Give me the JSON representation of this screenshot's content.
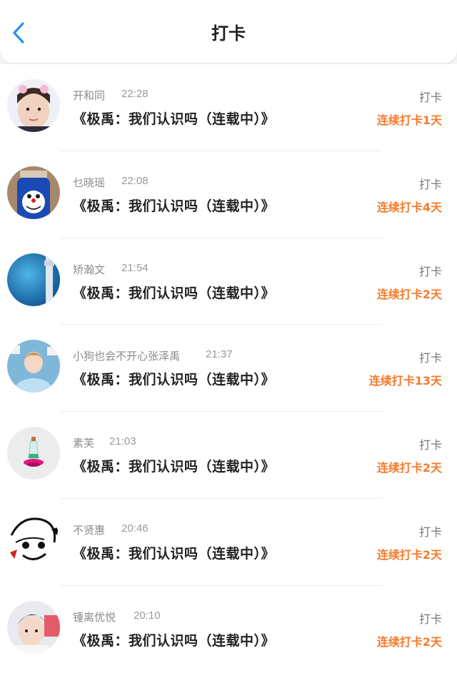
{
  "header": {
    "title": "打卡",
    "back_icon": "chevron-left-icon",
    "accent_color": "#2b8ff0"
  },
  "colors": {
    "streak": "#f57a2b",
    "name": "#8a8a8a",
    "title_text": "#222222"
  },
  "entries": [
    {
      "name": "开和同",
      "time": "22:28",
      "book": "《极禹：我们认识吗（连载中）》",
      "type": "打卡",
      "streak": "连续打卡1天"
    },
    {
      "name": "乜晓瑶",
      "time": "22:08",
      "book": "《极禹：我们认识吗（连载中）》",
      "type": "打卡",
      "streak": "连续打卡4天"
    },
    {
      "name": "矫瀚文",
      "time": "21:54",
      "book": "《极禹：我们认识吗（连载中）》",
      "type": "打卡",
      "streak": "连续打卡2天"
    },
    {
      "name": "小狗也会不开心张泽禹",
      "time": "21:37",
      "book": "《极禹：我们认识吗（连载中）》",
      "type": "打卡",
      "streak": "连续打卡13天"
    },
    {
      "name": "素芙",
      "time": "21:03",
      "book": "《极禹：我们认识吗（连载中）》",
      "type": "打卡",
      "streak": "连续打卡2天"
    },
    {
      "name": "不贤惠",
      "time": "20:46",
      "book": "《极禹：我们认识吗（连载中）》",
      "type": "打卡",
      "streak": "连续打卡2天"
    },
    {
      "name": "锺离优悦",
      "time": "20:10",
      "book": "《极禹：我们认识吗（连载中）》",
      "type": "打卡",
      "streak": "连续打卡2天"
    }
  ]
}
